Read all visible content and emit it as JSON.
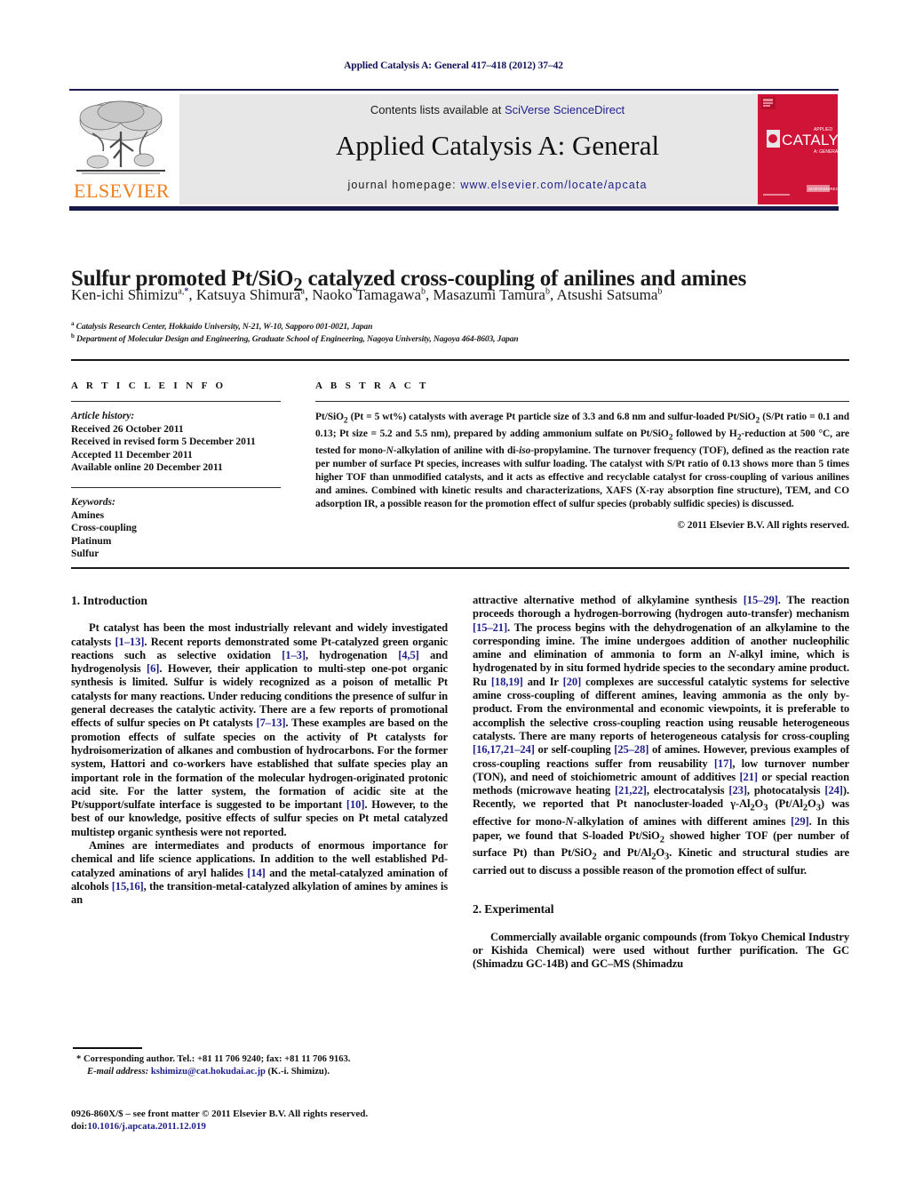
{
  "running_head": "Applied Catalysis A: General 417–418 (2012) 37–42",
  "masthead": {
    "contents_prefix": "Contents lists available at ",
    "contents_link": "SciVerse ScienceDirect",
    "journal_title": "Applied Catalysis A: General",
    "homepage_prefix": "journal homepage: ",
    "homepage_link": "www.elsevier.com/locate/apcata",
    "publisher_wordmark": "ELSEVIER",
    "cover_alt_title": "APPLIED CATALYSIS A: GENERAL"
  },
  "article": {
    "title_part1": "Sulfur promoted Pt/SiO",
    "title_sub": "2",
    "title_part2": " catalyzed cross-coupling of anilines and amines",
    "authors": [
      {
        "name": "Ken-ichi Shimizu",
        "marks": "a,",
        "star": "*"
      },
      {
        "name": "Katsuya Shimura",
        "marks": "a"
      },
      {
        "name": "Naoko Tamagawa",
        "marks": "b"
      },
      {
        "name": "Masazumi Tamura",
        "marks": "b"
      },
      {
        "name": "Atsushi Satsuma",
        "marks": "b"
      }
    ],
    "affiliations": [
      {
        "mark": "a",
        "text": "Catalysis Research Center, Hokkaido University, N-21, W-10, Sapporo 001-0021, Japan"
      },
      {
        "mark": "b",
        "text": "Department of Molecular Design and Engineering, Graduate School of Engineering, Nagoya University, Nagoya 464-8603, Japan"
      }
    ]
  },
  "info": {
    "heading": "A R T I C L E    I N F O",
    "history_label": "Article history:",
    "history": [
      "Received 26 October 2011",
      "Received in revised form 5 December 2011",
      "Accepted 11 December 2011",
      "Available online 20 December 2011"
    ],
    "keywords_label": "Keywords:",
    "keywords": [
      "Amines",
      "Cross-coupling",
      "Platinum",
      "Sulfur"
    ]
  },
  "abstract": {
    "heading": "A B S T R A C T",
    "copyright": "© 2011 Elsevier B.V. All rights reserved."
  },
  "body": {
    "intro_heading": "1.  Introduction",
    "experimental_heading": "2.  Experimental"
  },
  "footnote": {
    "corresponding": "* Corresponding author. Tel.: +81 11 706 9240; fax: +81 11 706 9163.",
    "email_label": "E-mail address:",
    "email": "kshimizu@cat.hokudai.ac.jp",
    "email_suffix": " (K.-i. Shimizu)."
  },
  "imprint": {
    "issn_line": "0926-860X/$ – see front matter © 2011 Elsevier B.V. All rights reserved.",
    "doi_label": "doi:",
    "doi_value": "10.1016/j.apcata.2011.12.019"
  }
}
